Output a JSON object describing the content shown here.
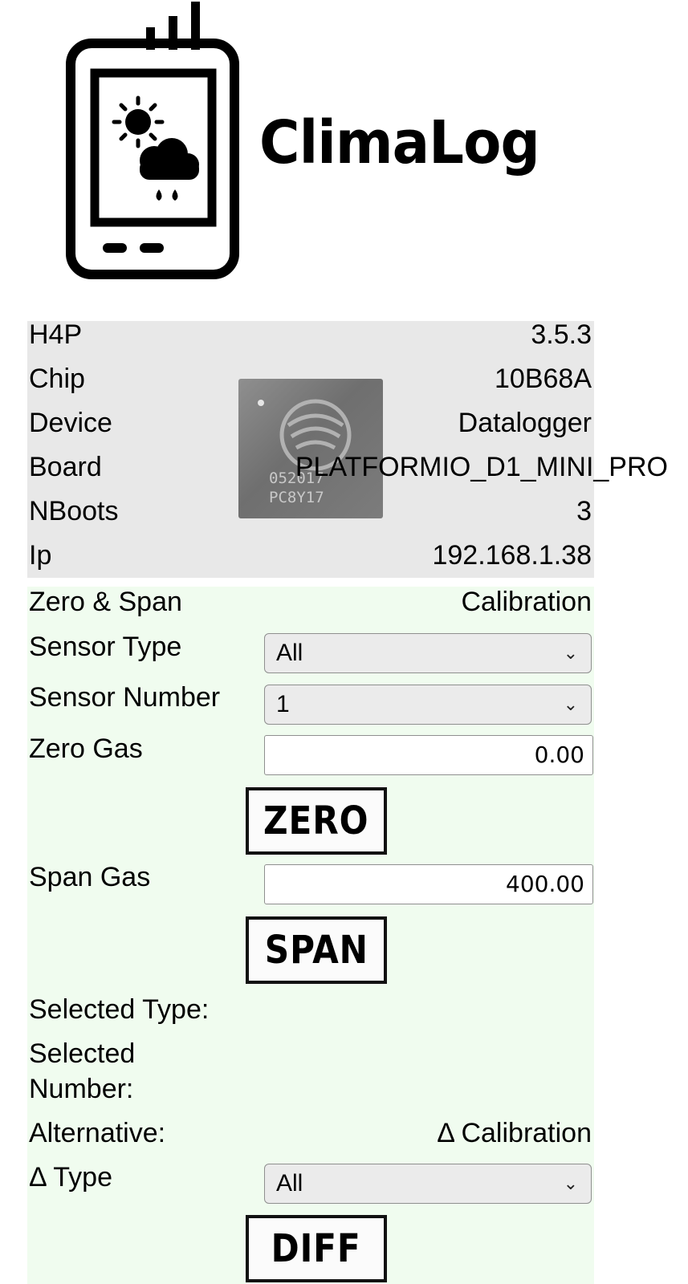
{
  "app": {
    "name": "ClimaLog"
  },
  "info": {
    "rows": [
      {
        "label": "H4P",
        "value": "3.5.3"
      },
      {
        "label": "Chip",
        "value": "10B68A"
      },
      {
        "label": "Device",
        "value": "Datalogger"
      },
      {
        "label": "Board",
        "value": "PLATFORMIO_D1_MINI_PRO"
      },
      {
        "label": "NBoots",
        "value": "3"
      },
      {
        "label": "Ip",
        "value": "192.168.1.38"
      }
    ],
    "chip_image_text": [
      "052017",
      "PC8Y17"
    ]
  },
  "calibration": {
    "heading_label": "Zero & Span",
    "heading_value": "Calibration",
    "sensor_type": {
      "label": "Sensor Type",
      "selected": "All"
    },
    "sensor_number": {
      "label": "Sensor Number",
      "selected": "1"
    },
    "zero_gas": {
      "label": "Zero Gas",
      "value": "0.00"
    },
    "zero_button": "ZERO",
    "span_gas": {
      "label": "Span Gas",
      "value": "400.00"
    },
    "span_button": "SPAN",
    "selected_type": {
      "label": "Selected Type:"
    },
    "selected_number": {
      "label_line1": "Selected",
      "label_line2": "Number:"
    },
    "alternative": {
      "label": "Alternative:",
      "value": "Δ Calibration"
    },
    "delta_type": {
      "label": "Δ Type",
      "selected": "All"
    },
    "diff_button": "DIFF"
  },
  "icons": [
    "datalogger-logo-icon",
    "sun-icon",
    "rain-cloud-icon",
    "esp-chip-icon",
    "chevron-down-icon"
  ]
}
